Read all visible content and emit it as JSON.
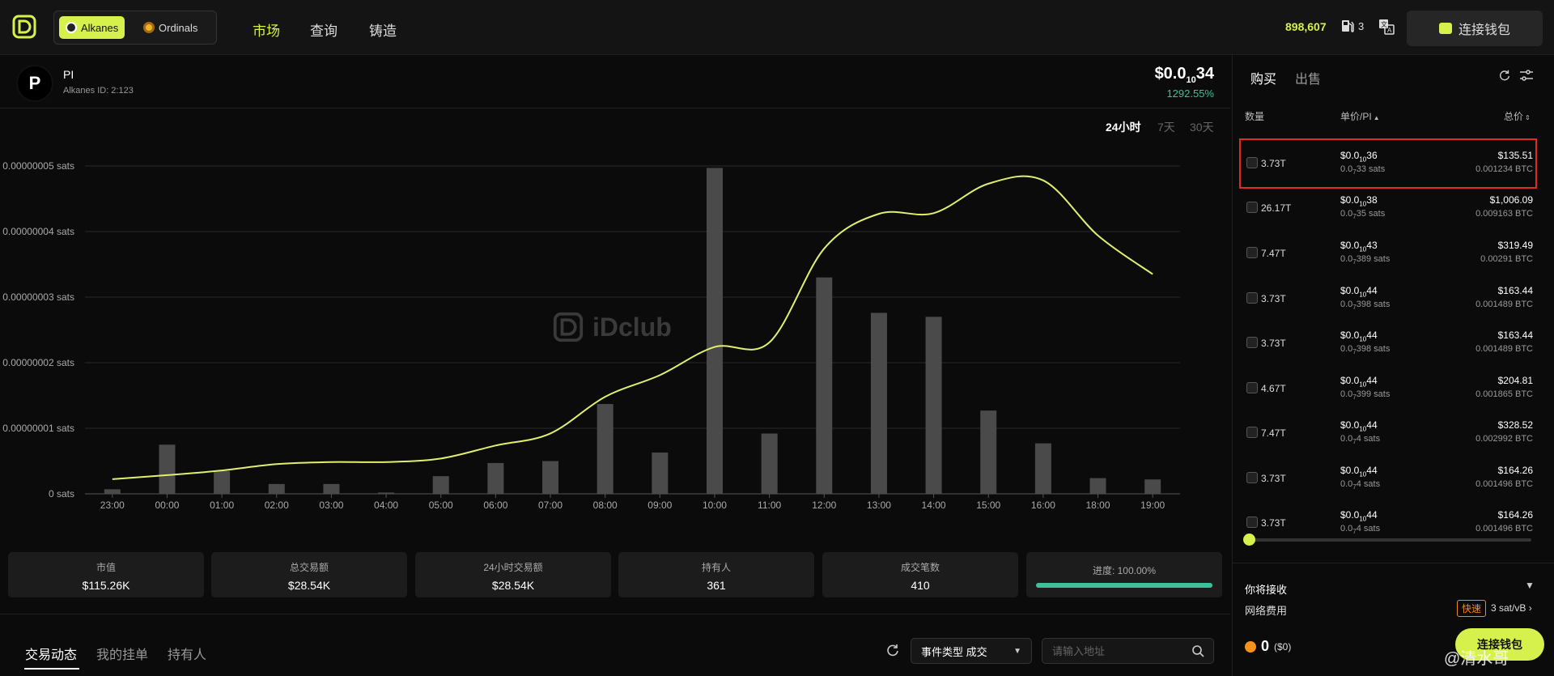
{
  "header": {
    "chains": [
      {
        "label": "Alkanes"
      },
      {
        "label": "Ordinals"
      }
    ],
    "nav": [
      {
        "label": "市场"
      },
      {
        "label": "查询"
      },
      {
        "label": "铸造"
      }
    ],
    "sats_count": "898,607",
    "gas_count": "3",
    "connect_label": "连接钱包"
  },
  "token": {
    "avatar_letter": "P",
    "name": "PI",
    "id": "Alkanes ID: 2:123",
    "price_main": "$0.0",
    "price_sub": "10",
    "price_tail": "34",
    "change": "1292.55%"
  },
  "timeframes": [
    {
      "label": "24小时"
    },
    {
      "label": "7天"
    },
    {
      "label": "30天"
    }
  ],
  "watermark": "iDclub",
  "chart_data": {
    "type": "bar",
    "categories": [
      "23:00",
      "00:00",
      "01:00",
      "02:00",
      "03:00",
      "04:00",
      "05:00",
      "06:00",
      "07:00",
      "08:00",
      "09:00",
      "10:00",
      "11:00",
      "12:00",
      "13:00",
      "14:00",
      "15:00",
      "16:00",
      "18:00",
      "19:00"
    ],
    "y_ticks": [
      "0 sats",
      "0.00000001 sats",
      "0.00000002 sats",
      "0.00000003 sats",
      "0.00000004 sats",
      "0.00000005 sats"
    ],
    "ylim": [
      0,
      5e-08
    ],
    "series": [
      {
        "type": "bar",
        "values": [
          0.7,
          7.5,
          3.5,
          1.5,
          1.5,
          0.2,
          2.7,
          4.7,
          5.0,
          13.7,
          6.3,
          49.7,
          9.2,
          33.0,
          27.6,
          27.0,
          12.7,
          7.7,
          2.4,
          2.2
        ]
      },
      {
        "type": "line",
        "values": [
          2.24e-09,
          2.85e-09,
          3.56e-09,
          4.53e-09,
          4.85e-09,
          4.85e-09,
          5.39e-09,
          7.37e-09,
          9.21e-09,
          1.48e-08,
          1.81e-08,
          2.24e-08,
          2.31e-08,
          3.74e-08,
          4.27e-08,
          4.28e-08,
          4.73e-08,
          4.78e-08,
          3.94e-08,
          3.35e-08
        ]
      }
    ],
    "colors": {
      "bar": "#4a4a4a",
      "line": "#e2ef6e",
      "grid": "#2a2a2a"
    }
  },
  "stats": [
    {
      "label": "市值",
      "value": "$115.26K"
    },
    {
      "label": "总交易额",
      "value": "$28.54K"
    },
    {
      "label": "24小时交易额",
      "value": "$28.54K"
    },
    {
      "label": "持有人",
      "value": "361"
    },
    {
      "label": "成交笔数",
      "value": "410"
    }
  ],
  "progress": {
    "label": "进度: 100.00%",
    "value": 1.0
  },
  "bottom_tabs": [
    {
      "label": "交易动态"
    },
    {
      "label": "我的挂单"
    },
    {
      "label": "持有人"
    }
  ],
  "event_type": "事件类型 成交",
  "address_placeholder": "请输入地址",
  "panel": {
    "tabs": [
      {
        "label": "购买"
      },
      {
        "label": "出售"
      }
    ],
    "columns": {
      "qty": "数量",
      "unit": "单价/PI",
      "total": "总价"
    },
    "orders": [
      {
        "qty": "3.73T",
        "up_main": "$0.0",
        "up_sub": "10",
        "up_tail": "36",
        "us_main": "0.0",
        "us_sub": "7",
        "us_tail": "33 sats",
        "tu": "$135.51",
        "tb": "0.001234 BTC"
      },
      {
        "qty": "26.17T",
        "up_main": "$0.0",
        "up_sub": "10",
        "up_tail": "38",
        "us_main": "0.0",
        "us_sub": "7",
        "us_tail": "35 sats",
        "tu": "$1,006.09",
        "tb": "0.009163 BTC"
      },
      {
        "qty": "7.47T",
        "up_main": "$0.0",
        "up_sub": "10",
        "up_tail": "43",
        "us_main": "0.0",
        "us_sub": "7",
        "us_tail": "389 sats",
        "tu": "$319.49",
        "tb": "0.00291 BTC"
      },
      {
        "qty": "3.73T",
        "up_main": "$0.0",
        "up_sub": "10",
        "up_tail": "44",
        "us_main": "0.0",
        "us_sub": "7",
        "us_tail": "398 sats",
        "tu": "$163.44",
        "tb": "0.001489 BTC"
      },
      {
        "qty": "3.73T",
        "up_main": "$0.0",
        "up_sub": "10",
        "up_tail": "44",
        "us_main": "0.0",
        "us_sub": "7",
        "us_tail": "398 sats",
        "tu": "$163.44",
        "tb": "0.001489 BTC"
      },
      {
        "qty": "4.67T",
        "up_main": "$0.0",
        "up_sub": "10",
        "up_tail": "44",
        "us_main": "0.0",
        "us_sub": "7",
        "us_tail": "399 sats",
        "tu": "$204.81",
        "tb": "0.001865 BTC"
      },
      {
        "qty": "7.47T",
        "up_main": "$0.0",
        "up_sub": "10",
        "up_tail": "44",
        "us_main": "0.0",
        "us_sub": "7",
        "us_tail": "4 sats",
        "tu": "$328.52",
        "tb": "0.002992 BTC"
      },
      {
        "qty": "3.73T",
        "up_main": "$0.0",
        "up_sub": "10",
        "up_tail": "44",
        "us_main": "0.0",
        "us_sub": "7",
        "us_tail": "4 sats",
        "tu": "$164.26",
        "tb": "0.001496 BTC"
      },
      {
        "qty": "3.73T",
        "up_main": "$0.0",
        "up_sub": "10",
        "up_tail": "44",
        "us_main": "0.0",
        "us_sub": "7",
        "us_tail": "4 sats",
        "tu": "$164.26",
        "tb": "0.001496 BTC"
      }
    ],
    "receive_label": "你将接收",
    "fee_label": "网络费用",
    "fee_tag": "快速",
    "fee_value": "3 sat/vB",
    "btc_amount": "0",
    "btc_usd": "($0)",
    "connect_label": "连接钱包"
  },
  "corner_watermark": "@清水哥"
}
